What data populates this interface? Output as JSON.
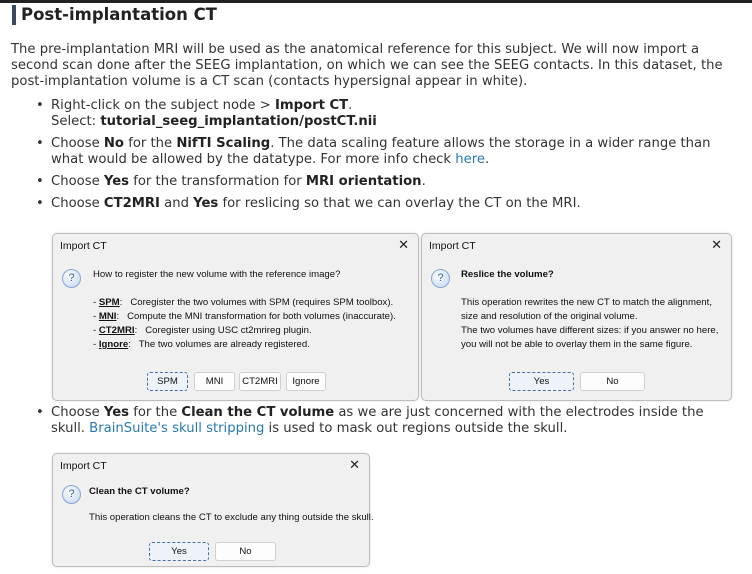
{
  "heading": "Post-implantation CT",
  "intro": "The pre-implantation MRI will be used as the anatomical reference for this subject. We will now import a second scan done after the SEEG implantation, on which we can see the SEEG contacts. In this dataset, the post-implantation volume is a CT scan (contacts hypersignal appear in white).",
  "bullets1": [
    [
      {
        "t": "Right-click on the subject node > "
      },
      {
        "t": "Import CT",
        "b": true
      },
      {
        "t": "."
      },
      {
        "br": true
      },
      {
        "t": "Select: "
      },
      {
        "t": "tutorial_seeg_implantation/postCT.nii",
        "b": true
      }
    ],
    [
      {
        "t": "Choose "
      },
      {
        "t": "No",
        "b": true
      },
      {
        "t": " for the "
      },
      {
        "t": "NifTI Scaling",
        "b": true
      },
      {
        "t": ". The data scaling feature allows the storage in a wider range than what would be allowed by the datatype. For more info check "
      },
      {
        "t": "here",
        "link": true
      },
      {
        "t": "."
      }
    ],
    [
      {
        "t": "Choose "
      },
      {
        "t": "Yes",
        "b": true
      },
      {
        "t": " for the transformation for "
      },
      {
        "t": "MRI orientation",
        "b": true
      },
      {
        "t": "."
      }
    ],
    [
      {
        "t": "Choose "
      },
      {
        "t": "CT2MRI",
        "b": true
      },
      {
        "t": " and "
      },
      {
        "t": "Yes",
        "b": true
      },
      {
        "t": " for reslicing so that we can overlay the CT on the MRI."
      }
    ]
  ],
  "bullets2": [
    [
      {
        "t": "Choose "
      },
      {
        "t": "Yes",
        "b": true
      },
      {
        "t": " for the "
      },
      {
        "t": "Clean the CT volume",
        "b": true
      },
      {
        "t": " as we are just concerned with the electrodes inside the skull. "
      },
      {
        "t": "BrainSuite's skull stripping",
        "link": true
      },
      {
        "t": " is used to mask out regions outside the skull."
      }
    ]
  ],
  "dialog_register": {
    "title": "Import CT",
    "question": "How to register the new volume with the reference image?",
    "options": [
      {
        "key": "SPM",
        "desc": ":   Coregister the two volumes with SPM (requires SPM toolbox)."
      },
      {
        "key": "MNI",
        "desc": ":   Compute the MNI transformation for both volumes (inaccurate)."
      },
      {
        "key": "CT2MRI",
        "desc": ":   Coregister using USC ct2mrireg plugin."
      },
      {
        "key": "Ignore",
        "desc": ":   The two volumes are already registered."
      }
    ],
    "buttons": [
      "SPM",
      "MNI",
      "CT2MRI",
      "Ignore"
    ]
  },
  "dialog_reslice": {
    "title": "Import CT",
    "question": "Reslice the volume?",
    "lines": [
      "This operation rewrites the new CT to match the alignment,",
      "size and resolution of the original volume.",
      "The two volumes have different sizes: if you answer no here,",
      "you will not be able to overlay them in the same figure."
    ],
    "buttons": [
      "Yes",
      "No"
    ]
  },
  "dialog_clean": {
    "title": "Import CT",
    "question": "Clean the CT volume?",
    "lines": [
      "This operation cleans the CT to exclude any thing outside the skull."
    ],
    "buttons": [
      "Yes",
      "No"
    ]
  },
  "icons": {
    "close": "close-icon",
    "question": "question-icon"
  }
}
